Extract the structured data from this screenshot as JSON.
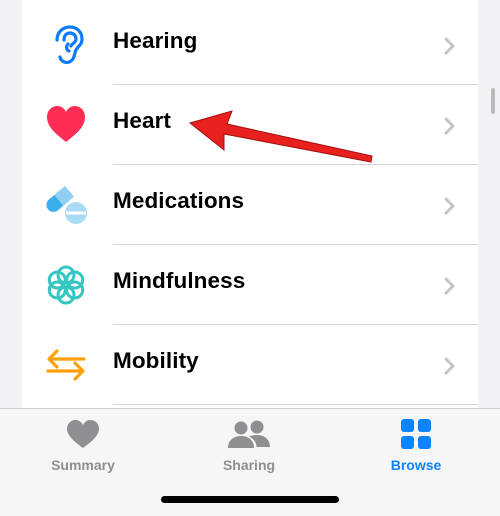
{
  "categories": [
    {
      "label": "Hearing",
      "icon": "ear-icon"
    },
    {
      "label": "Heart",
      "icon": "heart-icon"
    },
    {
      "label": "Medications",
      "icon": "pills-icon"
    },
    {
      "label": "Mindfulness",
      "icon": "mindfulness-flower-icon"
    },
    {
      "label": "Mobility",
      "icon": "arrows-left-right-icon"
    }
  ],
  "tabbar": {
    "tabs": [
      {
        "label": "Summary",
        "icon": "heart-icon",
        "active": false
      },
      {
        "label": "Sharing",
        "icon": "people-icon",
        "active": false
      },
      {
        "label": "Browse",
        "icon": "grid-icon",
        "active": true
      }
    ]
  },
  "colors": {
    "accent": "#0a84ff",
    "inactive_tab": "#8e8e93",
    "heart": "#ff2d55",
    "hearing": "#0a7aff",
    "medications": "#3aaee8",
    "mindfulness": "#34c6c0",
    "mobility": "#ff9f0a",
    "annotation_arrow": "#e8201e"
  }
}
